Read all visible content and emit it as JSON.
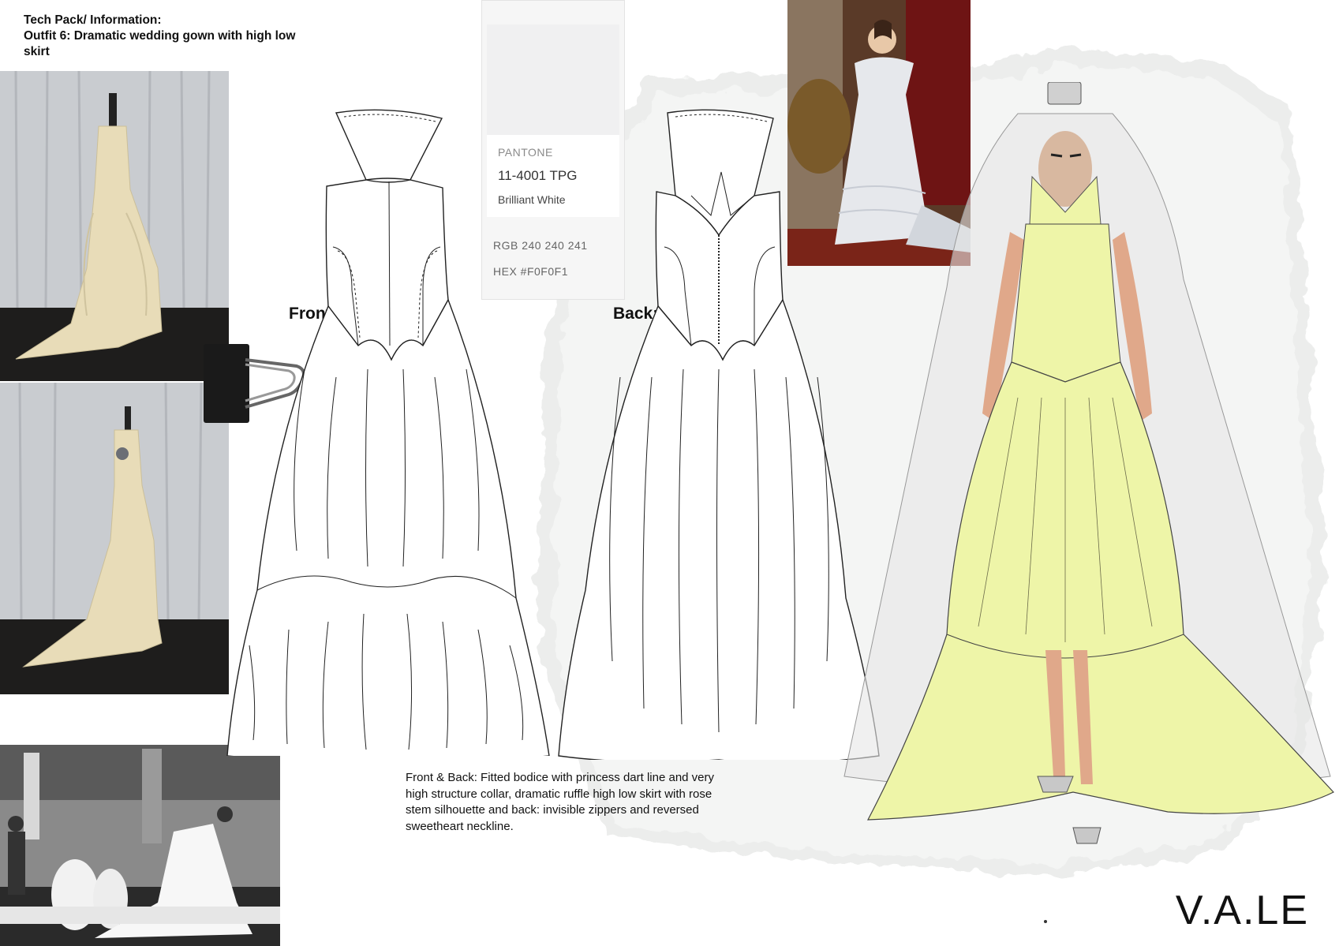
{
  "header": {
    "line1": "Tech Pack/ Information:",
    "line2": "Outfit 6: Dramatic wedding gown with high low skirt"
  },
  "labels": {
    "front": "Front:",
    "back": "Back:"
  },
  "pantone": {
    "brand": "PANTONE",
    "code": "11-4001 TPG",
    "name": "Brilliant White",
    "rgb": "RGB  240 240 241",
    "hex": "HEX #F0F0F1"
  },
  "description": "Front & Back: Fitted bodice with princess dart line and very high structure collar, dramatic ruffle high low skirt with rose stem silhouette and back: invisible zippers and reversed sweetheart neckline.",
  "logo": "V.A.LE",
  "colors": {
    "swatch": "#F0F0F1",
    "gown_yellow": "#eef5a8",
    "ivory_fabric": "#e8dcb8",
    "line": "#222222"
  }
}
